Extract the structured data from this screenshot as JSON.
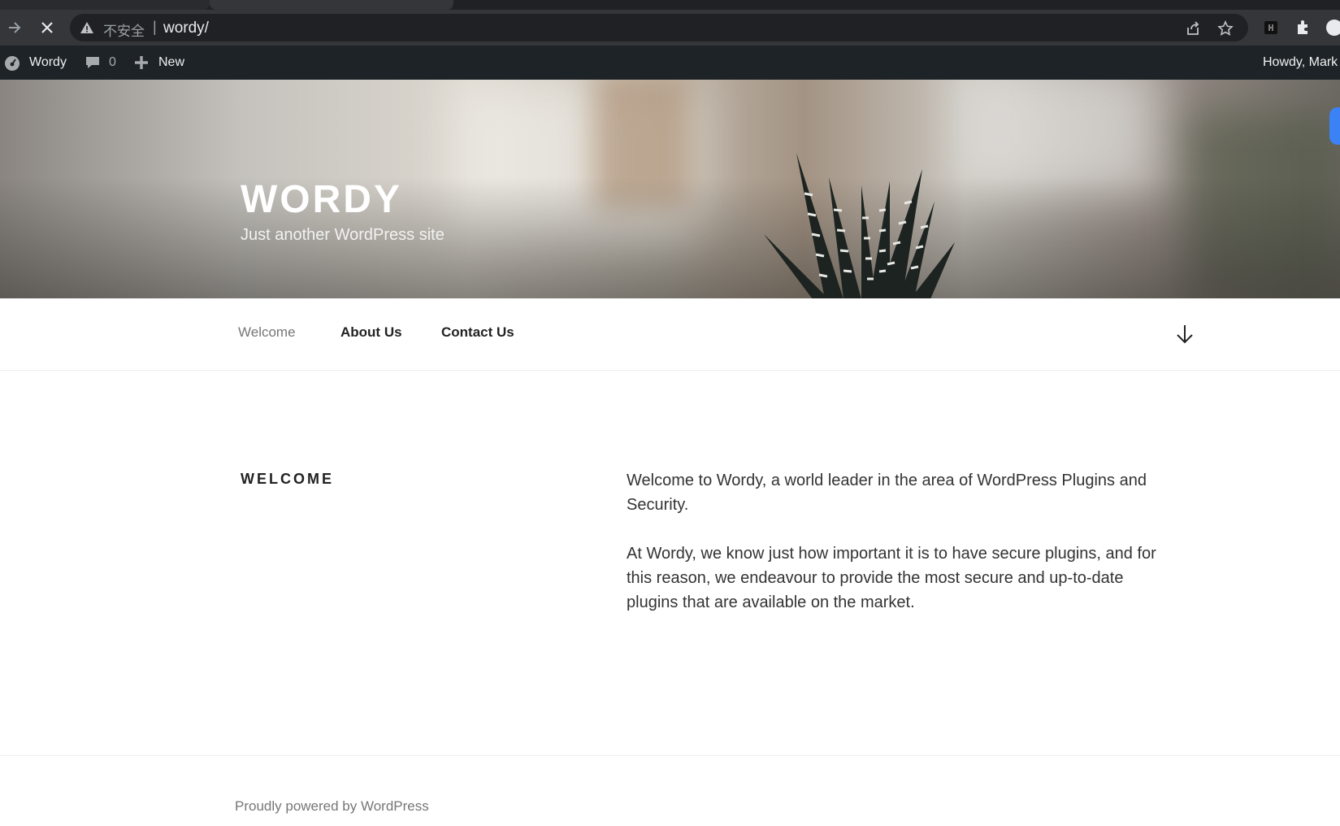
{
  "browser": {
    "security_label": "不安全",
    "separator": "|",
    "url": "wordy/"
  },
  "adminbar": {
    "site_name": "Wordy",
    "comments_count": "0",
    "new_label": "New",
    "howdy": "Howdy, Mark"
  },
  "site": {
    "title": "WORDY",
    "description": "Just another WordPress site"
  },
  "nav": {
    "items": [
      {
        "label": "Welcome",
        "current": true
      },
      {
        "label": "About Us",
        "current": false
      },
      {
        "label": "Contact Us",
        "current": false
      }
    ]
  },
  "page": {
    "title": "WELCOME",
    "paragraphs": [
      "Welcome to Wordy, a world leader in the area of WordPress Plugins and Security.",
      "At Wordy, we know just how important it is to have secure plugins, and for this reason, we endeavour to provide the most secure and up-to-date plugins that are available on the market."
    ]
  },
  "footer": {
    "credit": "Proudly powered by WordPress"
  }
}
